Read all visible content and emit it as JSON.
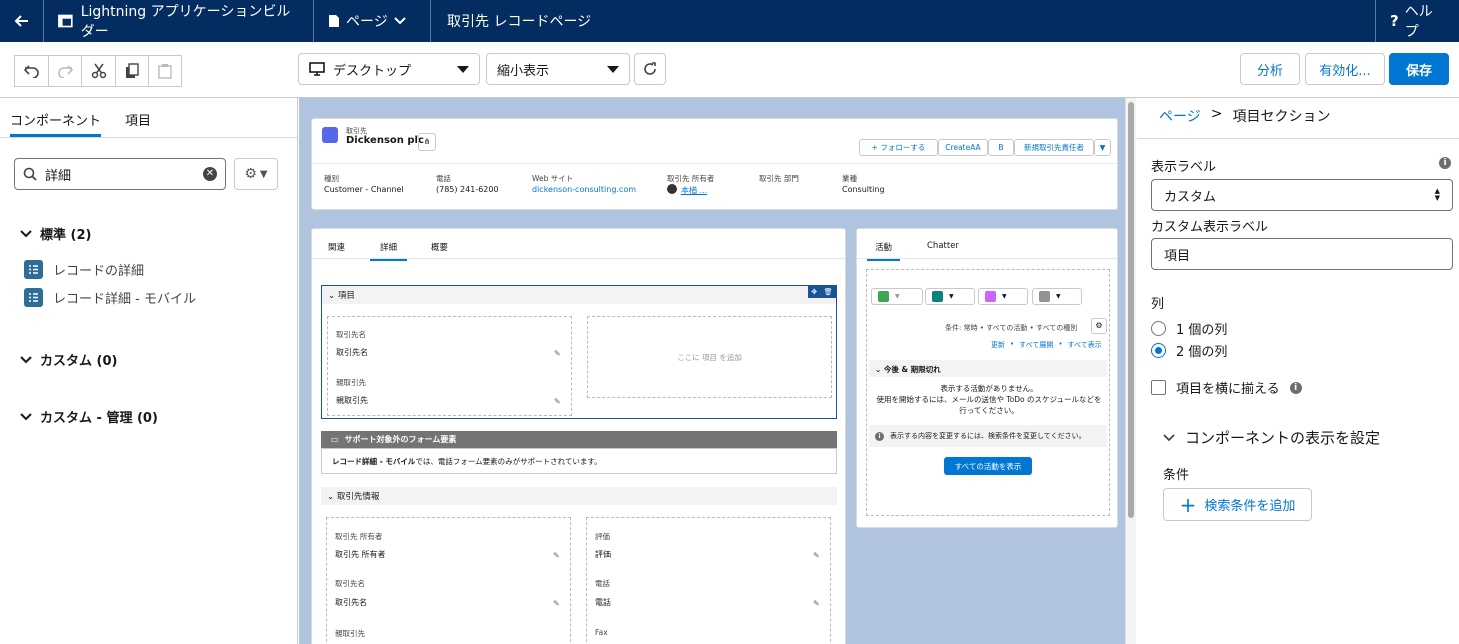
{
  "topbar": {
    "app_name": "Lightning アプリケーションビルダー",
    "page_menu": "ページ",
    "record_page": "取引先 レコードページ",
    "help": "ヘルプ"
  },
  "toolbar": {
    "device": "デスクトップ",
    "zoom": "縮小表示",
    "analyze": "分析",
    "activate": "有効化...",
    "save": "保存"
  },
  "left": {
    "tabs": [
      "コンポーネント",
      "項目"
    ],
    "search_value": "詳細",
    "sections": {
      "standard": "標準 (2)",
      "custom": "カスタム (0)",
      "custom_managed": "カスタム - 管理 (0)"
    },
    "components": [
      "レコードの詳細",
      "レコード詳細 - モバイル"
    ]
  },
  "preview": {
    "object_label": "取引先",
    "record_name": "Dickenson plc",
    "actions": [
      "フォローする",
      "CreateAA",
      "B",
      "新規取引先責任者"
    ],
    "highlights": [
      {
        "label": "種別",
        "value": "Customer - Channel"
      },
      {
        "label": "電話",
        "value": "(785) 241-6200"
      },
      {
        "label": "Web サイト",
        "value": "dickenson-consulting.com"
      },
      {
        "label": "取引先 所有者",
        "value": "本楢 ..."
      },
      {
        "label": "取引先 部門",
        "value": ""
      },
      {
        "label": "業種",
        "value": "Consulting"
      }
    ],
    "main_tabs": [
      "関連",
      "詳細",
      "概要"
    ],
    "section1_title": "項目",
    "fields1": [
      {
        "label": "取引先名",
        "value": "取引先名"
      },
      {
        "label": "親取引先",
        "value": "親取引先"
      }
    ],
    "add_field_hint": "ここに 項目 を追加",
    "warning_title": "サポート対象外のフォーム要素",
    "warning_bold": "レコード詳細 - モバイル",
    "warning_text": "では、電話フォーム要素のみがサポートされています。",
    "section2_title": "取引先情報",
    "fields2_left": [
      {
        "label": "取引先 所有者",
        "value": "取引先 所有者"
      },
      {
        "label": "取引先名",
        "value": "取引先名"
      },
      {
        "label": "親取引先",
        "value": ""
      }
    ],
    "fields2_right": [
      {
        "label": "評価",
        "value": "評価"
      },
      {
        "label": "電話",
        "value": "電話"
      },
      {
        "label": "Fax",
        "value": ""
      }
    ],
    "side_tabs": [
      "活動",
      "Chatter"
    ],
    "filter_text": "条件: 常時 • すべての活動 • すべての種別",
    "filter_links": [
      "更新",
      "すべて展開",
      "すべて表示"
    ],
    "upcoming_title": "今後 & 期限切れ",
    "no_activity_1": "表示する活動がありません。",
    "no_activity_2": "使用を開始するには、メールの送信や ToDo のスケジュールなどを行ってください。",
    "filter_hint": "表示する内容を変更するには、検索条件を変更してください。",
    "show_all_btn": "すべての活動を表示"
  },
  "right": {
    "crumb_parent": "ページ",
    "crumb_current": "項目セクション",
    "display_label": "表示ラベル",
    "display_label_value": "カスタム",
    "custom_label": "カスタム表示ラベル",
    "custom_label_value": "項目",
    "columns_label": "列",
    "col_options": [
      "1 個の列",
      "2 個の列"
    ],
    "col_selected": 1,
    "align_label": "項目を横に揃える",
    "visibility_title": "コンポーネントの表示を設定",
    "conditions_label": "条件",
    "add_filter": "検索条件を追加"
  },
  "colors": {
    "nav": "#032d60",
    "brand": "#0176d3",
    "canvas": "#b0c4df"
  }
}
